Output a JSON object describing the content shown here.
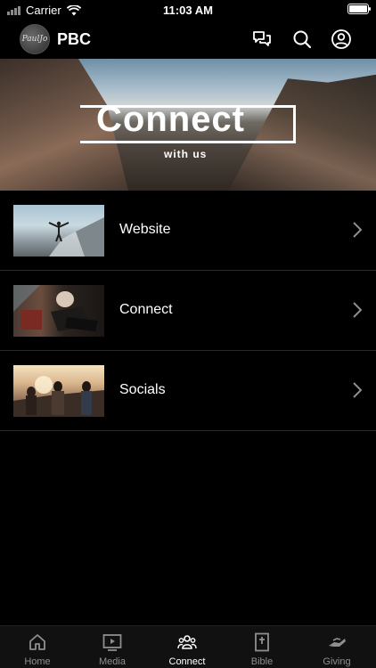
{
  "status": {
    "carrier": "Carrier",
    "time": "11:03 AM"
  },
  "header": {
    "title": "PBC",
    "avatar_text": "PaulJo"
  },
  "hero": {
    "title": "Connect",
    "subtitle": "with us"
  },
  "list": [
    {
      "label": "Website"
    },
    {
      "label": "Connect"
    },
    {
      "label": "Socials"
    }
  ],
  "tabs": [
    {
      "label": "Home",
      "icon": "home-icon",
      "active": false
    },
    {
      "label": "Media",
      "icon": "play-icon",
      "active": false
    },
    {
      "label": "Connect",
      "icon": "people-icon",
      "active": true
    },
    {
      "label": "Bible",
      "icon": "bible-icon",
      "active": false
    },
    {
      "label": "Giving",
      "icon": "giving-icon",
      "active": false
    }
  ],
  "colors": {
    "background": "#000000",
    "tab_inactive": "#8e8e93",
    "tab_active": "#ffffff",
    "divider": "#2b2b2b"
  }
}
